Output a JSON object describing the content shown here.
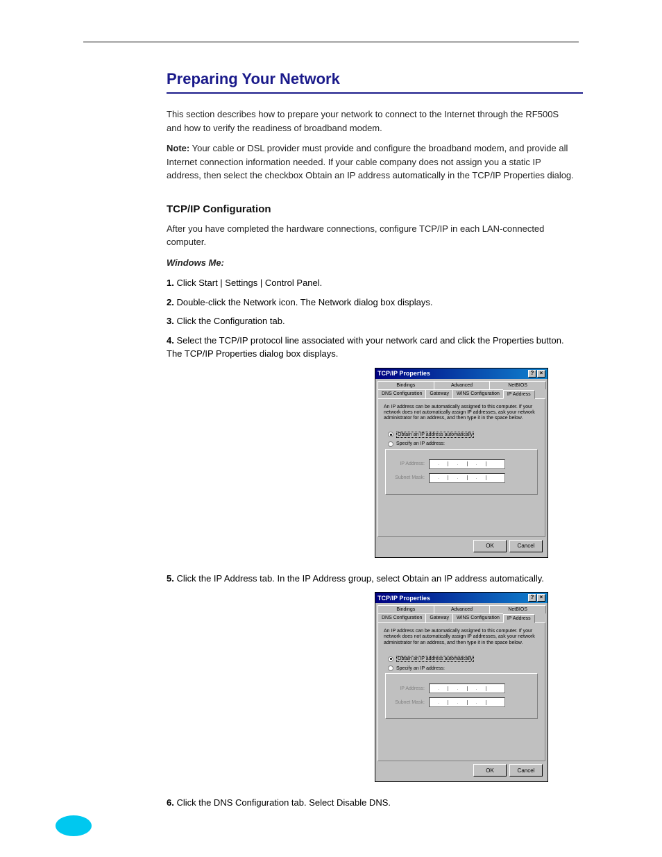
{
  "page": {
    "section_title": "Preparing Your Network",
    "intro_1": "This section describes how to prepare your network to connect to the Internet through the RF500S and how to verify the readiness of broadband modem.",
    "note_label": "Note:",
    "note_text": "Your cable or DSL provider must provide and configure the broadband modem, and provide all Internet connection information needed. If your cable company does not assign you a static IP address, then select the checkbox Obtain an IP address automatically in the TCP/IP Properties dialog.",
    "subhead": "TCP/IP Configuration",
    "subhead_text": "After you have completed the hardware connections, configure TCP/IP in each LAN-connected computer.",
    "winme_heading": "Windows Me:",
    "steps": [
      {
        "num": "1.",
        "text": "Click Start | Settings | Control Panel."
      },
      {
        "num": "2.",
        "text": "Double-click the Network icon. The Network dialog box displays."
      },
      {
        "num": "3.",
        "text": "Click the Configuration tab."
      },
      {
        "num": "4.",
        "text": "Select the TCP/IP protocol line associated with your network card and click the Properties button. The TCP/IP Properties dialog box displays."
      },
      {
        "num": "5.",
        "text": "Click the IP Address tab. In the IP Address group, select Obtain an IP address automatically."
      }
    ],
    "step6": {
      "num": "6.",
      "text": "Click the DNS Configuration tab. Select Disable DNS."
    }
  },
  "dialog": {
    "title": "TCP/IP Properties",
    "helpbtn": "?",
    "closebtn": "×",
    "tabs_top": [
      "Bindings",
      "Advanced",
      "NetBIOS"
    ],
    "tabs_bottom": [
      "DNS Configuration",
      "Gateway",
      "WINS Configuration",
      "IP Address"
    ],
    "help_text": "An IP address can be automatically assigned to this computer. If your network does not automatically assign IP addresses, ask your network administrator for an address, and then type it in the space below.",
    "radio_auto": "Obtain an IP address automatically",
    "radio_specify": "Specify an IP address:",
    "ip_label": "IP Address:",
    "mask_label": "Subnet Mask:",
    "ok": "OK",
    "cancel": "Cancel"
  }
}
